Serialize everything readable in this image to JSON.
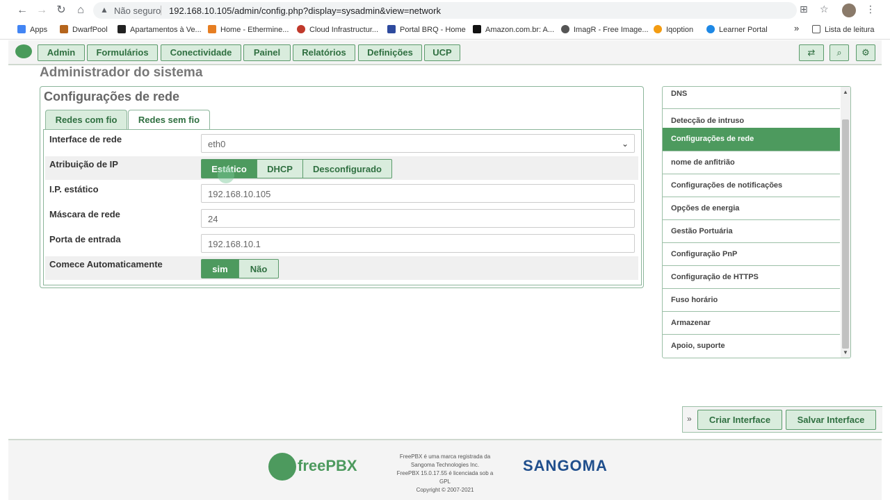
{
  "browser": {
    "insecure_label": "Não seguro",
    "url": "192.168.10.105/admin/config.php?display=sysadmin&view=network",
    "bookmarks": [
      {
        "label": "Apps",
        "color": "#4285f4"
      },
      {
        "label": "DwarfPool",
        "color": "#b5651d"
      },
      {
        "label": "Apartamentos à Ve...",
        "color": "#222222"
      },
      {
        "label": "Home - Ethermine...",
        "color": "#e67e22"
      },
      {
        "label": "Cloud Infrastructur...",
        "color": "#c0392b"
      },
      {
        "label": "Portal BRQ - Home",
        "color": "#2e4a9e"
      },
      {
        "label": "Amazon.com.br: A...",
        "color": "#111111"
      },
      {
        "label": "ImagR - Free Image...",
        "color": "#555555"
      },
      {
        "label": "Iqoption",
        "color": "#f39c12"
      },
      {
        "label": "Learner Portal",
        "color": "#1e88e5"
      }
    ],
    "reading_list": "Lista de leitura"
  },
  "menu": [
    "Admin",
    "Formulários",
    "Conectividade",
    "Painel",
    "Relatórios",
    "Definições",
    "UCP"
  ],
  "page_title": "Administrador do sistema",
  "panel": {
    "title": "Configurações de rede",
    "tabs": [
      "Redes com fio",
      "Redes sem fio"
    ],
    "rows": {
      "interface_label": "Interface de rede",
      "interface_value": "eth0",
      "ip_assign_label": "Atribuição de IP",
      "ip_assign_options": [
        "Estático",
        "DHCP",
        "Desconfigurado"
      ],
      "static_ip_label": "I.P. estático",
      "static_ip_value": "192.168.10.105",
      "netmask_label": "Máscara de rede",
      "netmask_value": "24",
      "gateway_label": "Porta de entrada",
      "gateway_value": "192.168.10.1",
      "autostart_label": "Comece Automaticamente",
      "autostart_options": [
        "sim",
        "Não"
      ]
    }
  },
  "sidebar": [
    "DNS",
    "Detecção de intruso",
    "Configurações de rede",
    "nome de anfitrião",
    "Configurações de notificações",
    "Opções de energia",
    "Gestão Portuária",
    "Configuração PnP",
    "Configuração de HTTPS",
    "Fuso horário",
    "Armazenar",
    "Apoio, suporte"
  ],
  "actions": {
    "create": "Criar Interface",
    "save": "Salvar Interface"
  },
  "footer": {
    "brand": "freePBX",
    "note_lines": [
      "FreePBX é uma marca registrada da",
      "Sangoma Technologies Inc.",
      "FreePBX 15.0.17.55 é licenciada sob a",
      "GPL",
      "Copyright © 2007-2021"
    ],
    "sangoma": "SANGOMA"
  },
  "colors": {
    "accent": "#4d9a5e",
    "accent_light": "#d9ecdd",
    "accent_text": "#2f6f40"
  }
}
